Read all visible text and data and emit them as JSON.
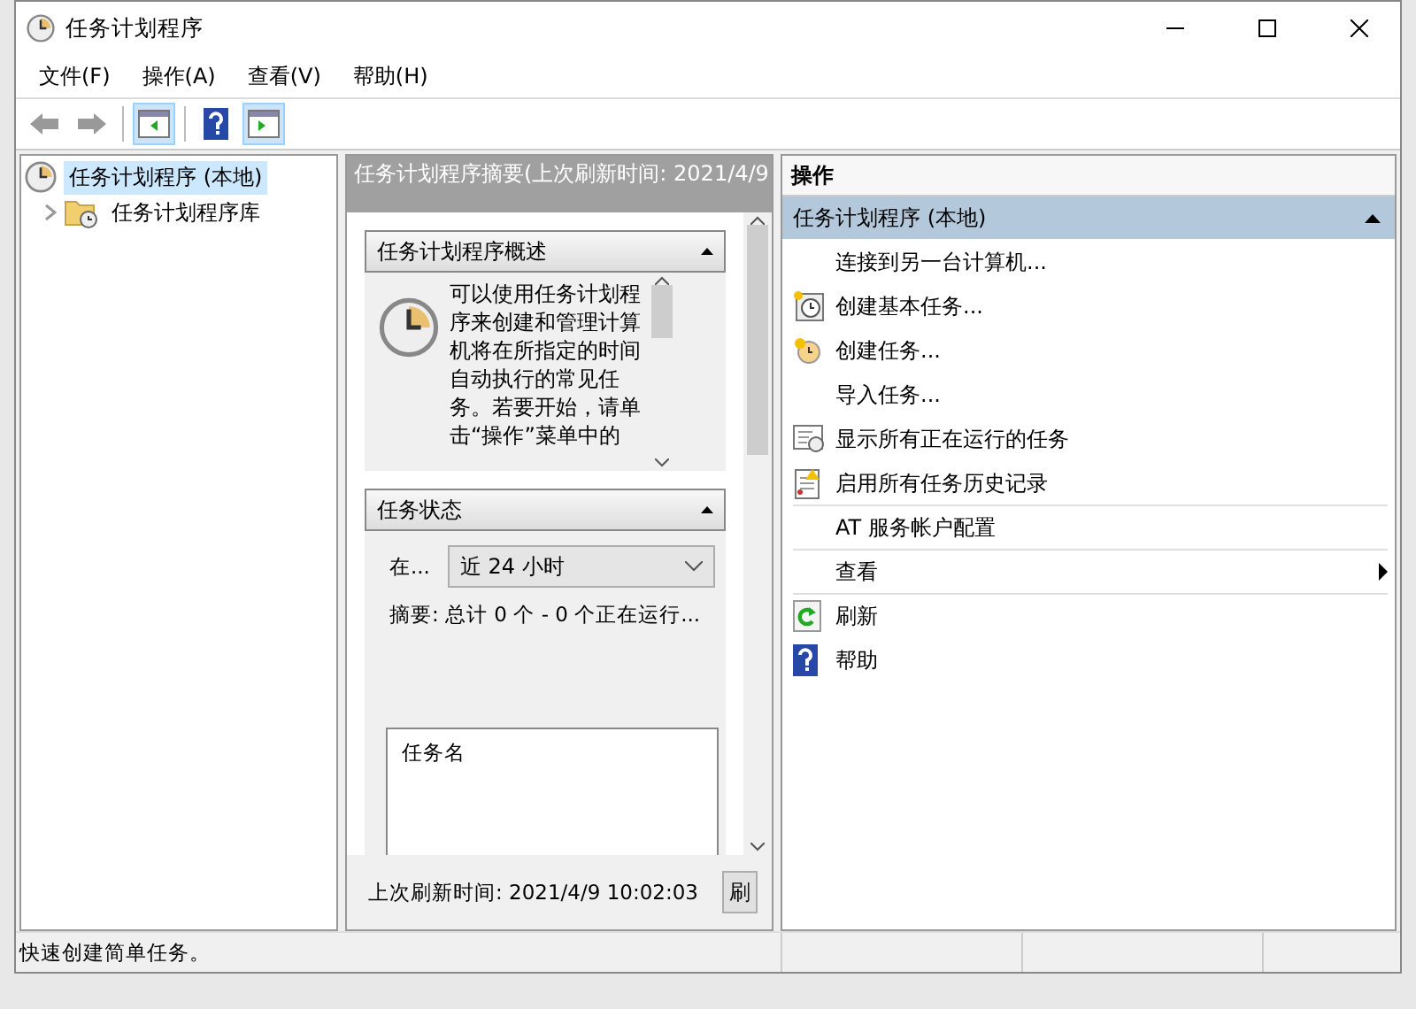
{
  "window": {
    "title": "任务计划程序"
  },
  "menu": [
    "文件(F)",
    "操作(A)",
    "查看(V)",
    "帮助(H)"
  ],
  "toolbar": [
    {
      "kind": "back",
      "pressed": false
    },
    {
      "kind": "forward",
      "pressed": false
    },
    {
      "kind": "tree",
      "pressed": true
    },
    {
      "kind": "help",
      "pressed": false
    },
    {
      "kind": "actions",
      "pressed": true
    }
  ],
  "tree": [
    {
      "label": "任务计划程序 (本地)",
      "selected": true,
      "children": [
        {
          "label": "任务计划程序库",
          "selected": false,
          "expanded": false
        }
      ]
    }
  ],
  "summary": {
    "header": "任务计划程序摘要(上次刷新时间: 2021/4/9",
    "overview": {
      "title": "任务计划程序概述",
      "text": "可以使用任务计划程序来创建和管理计算机将在所指定的时间自动执行的常见任务。若要开始，请单击“操作”菜单中的"
    },
    "status": {
      "title": "任务状态",
      "period_label": "在...",
      "period": "近 24 小时",
      "summary": "摘要: 总计 0 个 - 0 个正在运行...",
      "list_header": "任务名"
    },
    "last_refresh": "上次刷新时间: 2021/4/9 10:02:03",
    "refresh_button": "刷"
  },
  "actions": {
    "title": "操作",
    "section": "任务计划程序 (本地)",
    "items": [
      {
        "label": "连接到另一台计算机...",
        "kind": "plain",
        "separated": false
      },
      {
        "label": "创建基本任务...",
        "kind": "basic",
        "separated": false
      },
      {
        "label": "创建任务...",
        "kind": "create",
        "separated": false
      },
      {
        "label": "导入任务...",
        "kind": "plain",
        "separated": false
      },
      {
        "label": "显示所有正在运行的任务",
        "kind": "running",
        "separated": false
      },
      {
        "label": "启用所有任务历史记录",
        "kind": "history",
        "separated": false
      },
      {
        "label": "AT 服务帐户配置",
        "kind": "plain",
        "separated": true
      },
      {
        "label": "查看",
        "kind": "submenu",
        "separated": true
      },
      {
        "label": "刷新",
        "kind": "refresh",
        "separated": true
      },
      {
        "label": "帮助",
        "kind": "help",
        "separated": false
      }
    ]
  },
  "status_bar": "快速创建简单任务。"
}
